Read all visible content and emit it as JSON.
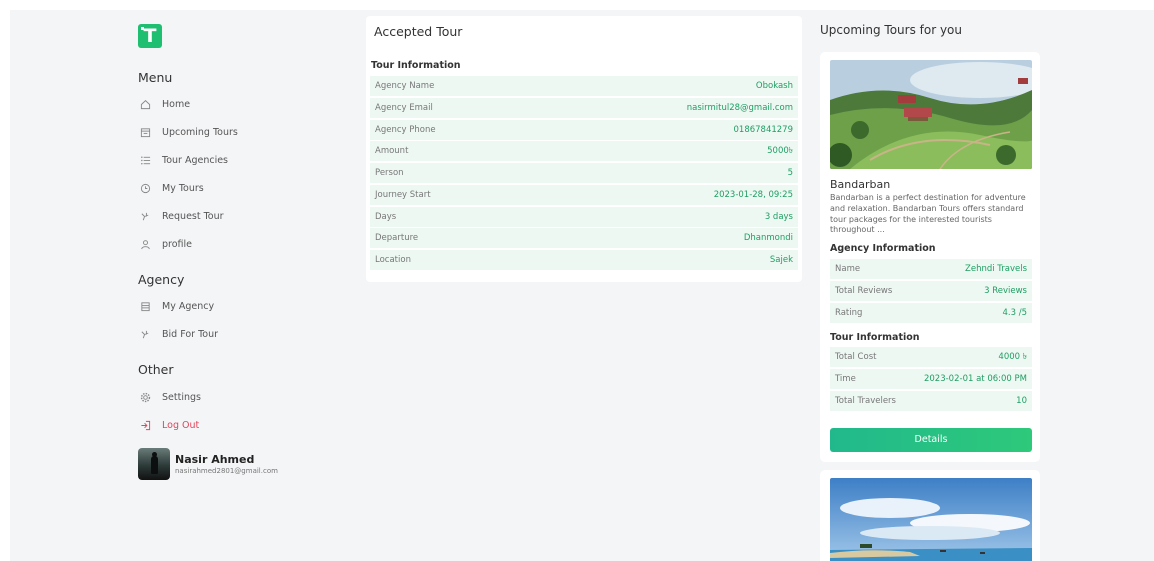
{
  "sidebar": {
    "menu_title": "Menu",
    "menu_items": [
      {
        "label": "Home",
        "icon": "home-icon"
      },
      {
        "label": "Upcoming Tours",
        "icon": "calendar-icon"
      },
      {
        "label": "Tour Agencies",
        "icon": "list-icon"
      },
      {
        "label": "My Tours",
        "icon": "clock-icon"
      },
      {
        "label": "Request Tour",
        "icon": "hand-icon"
      },
      {
        "label": "profile",
        "icon": "user-icon"
      }
    ],
    "agency_title": "Agency",
    "agency_items": [
      {
        "label": "My Agency",
        "icon": "building-icon"
      },
      {
        "label": "Bid For Tour",
        "icon": "bid-icon"
      }
    ],
    "other_title": "Other",
    "other_items": [
      {
        "label": "Settings",
        "icon": "gear-icon"
      },
      {
        "label": "Log Out",
        "icon": "logout-icon"
      }
    ],
    "user": {
      "name": "Nasir Ahmed",
      "email": "nasirahmed2801@gmail.com"
    }
  },
  "main": {
    "title": "Accepted Tour",
    "section_title": "Tour Information",
    "rows": [
      {
        "label": "Agency Name",
        "value": "Obokash"
      },
      {
        "label": "Agency Email",
        "value": "nasirmitul28@gmail.com"
      },
      {
        "label": "Agency Phone",
        "value": "01867841279"
      },
      {
        "label": "Amount",
        "value": "5000৳"
      },
      {
        "label": "Person",
        "value": "5"
      },
      {
        "label": "Journey Start",
        "value": "2023-01-28, 09:25"
      },
      {
        "label": "Days",
        "value": "3 days"
      },
      {
        "label": "Departure",
        "value": "Dhanmondi"
      },
      {
        "label": "Location",
        "value": "Sajek"
      }
    ]
  },
  "upcoming": {
    "title": "Upcoming Tours for you",
    "card": {
      "name": "Bandarban",
      "description": "Bandarban is a perfect destination for adventure and relaxation. Bandarban Tours offers standard tour packages for the interested tourists throughout ...",
      "agency_title": "Agency Information",
      "agency_rows": [
        {
          "label": "Name",
          "value": "Zehndi Travels"
        },
        {
          "label": "Total Reviews",
          "value": "3 Reviews"
        },
        {
          "label": "Rating",
          "value": "4.3 /5"
        }
      ],
      "tour_title": "Tour Information",
      "tour_rows": [
        {
          "label": "Total Cost",
          "value": "4000 ৳"
        },
        {
          "label": "Time",
          "value": "2023-02-01 at 06:00 PM"
        },
        {
          "label": "Total Travelers",
          "value": "10"
        }
      ],
      "button": "Details"
    }
  },
  "colors": {
    "accent": "#1fbf71",
    "value_text": "#1e9e62",
    "row_bg": "#eef8f3",
    "logout": "#e0445a"
  }
}
